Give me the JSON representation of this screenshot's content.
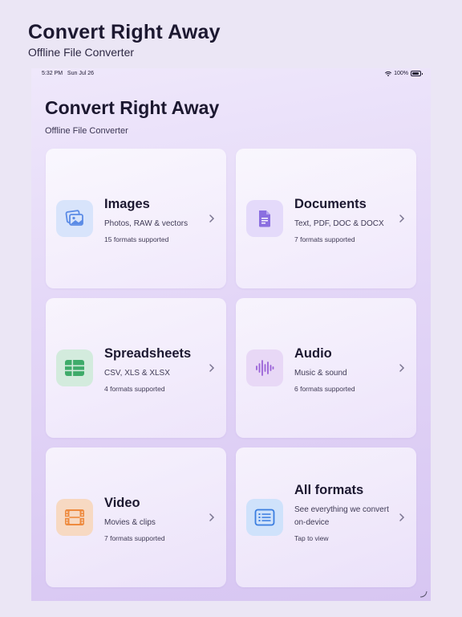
{
  "hero": {
    "title": "Convert Right Away",
    "subtitle": "Offline File Converter"
  },
  "status_bar": {
    "time": "5:32 PM",
    "date": "Sun Jul 26",
    "battery": "100%"
  },
  "app": {
    "title": "Convert Right Away",
    "subtitle": "Offline File Converter"
  },
  "cards": [
    {
      "title": "Images",
      "description": "Photos, RAW & vectors",
      "count": "15 formats supported",
      "icon": "images-icon",
      "color": "#5b8be6"
    },
    {
      "title": "Documents",
      "description": "Text, PDF, DOC & DOCX",
      "count": "7 formats supported",
      "icon": "document-icon",
      "color": "#8b6fe0"
    },
    {
      "title": "Spreadsheets",
      "description": "CSV, XLS & XLSX",
      "count": "4 formats supported",
      "icon": "spreadsheet-icon",
      "color": "#3fab6a"
    },
    {
      "title": "Audio",
      "description": "Music & sound",
      "count": "6 formats supported",
      "icon": "audio-waveform-icon",
      "color": "#9a62d8"
    },
    {
      "title": "Video",
      "description": "Movies & clips",
      "count": "7 formats supported",
      "icon": "film-icon",
      "color": "#ee8a3e"
    },
    {
      "title": "All formats",
      "description": "See everything we convert on-device",
      "count": "Tap to view",
      "icon": "list-icon",
      "color": "#3a7de0"
    }
  ]
}
